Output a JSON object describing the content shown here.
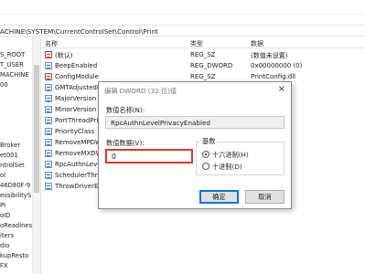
{
  "menubar": {
    "items": [
      "",
      "",
      "",
      "",
      ""
    ]
  },
  "address": {
    "path": "ACHINE\\SYSTEM\\CurrentControlSet\\Control\\Print"
  },
  "tree": {
    "items": [
      "S_ROOT",
      "T_USER",
      "MACHINE",
      "00",
      "",
      "",
      "",
      "",
      "",
      "",
      "",
      "Broker",
      "et001",
      "ntrolSet",
      "ol",
      "46D80F-9",
      "essibilityS",
      "PI",
      "oID",
      "oReadines",
      "iters",
      "dio",
      "kupResto",
      "FX"
    ]
  },
  "list": {
    "headers": {
      "name": "名称",
      "type": "类型",
      "data": "数据"
    },
    "rows": [
      {
        "name": "(默认)",
        "type": "REG_SZ",
        "data": "(数值未设置)",
        "kind": "str"
      },
      {
        "name": "BeepEnabled",
        "type": "REG_DWORD",
        "data": "0x00000000 (0)",
        "kind": "bin"
      },
      {
        "name": "ConfigModule",
        "type": "REG_SZ",
        "data": "PrintConfig.dll",
        "kind": "str"
      },
      {
        "name": "GMTAdjustedFo",
        "type": "",
        "data": "",
        "kind": "bin"
      },
      {
        "name": "MajorVersion",
        "type": "",
        "data": "",
        "kind": "bin"
      },
      {
        "name": "MinorVersion",
        "type": "",
        "data": "",
        "kind": "bin"
      },
      {
        "name": "PortThreadPrior",
        "type": "",
        "data": "",
        "kind": "bin"
      },
      {
        "name": "PriorityClass",
        "type": "",
        "data": "",
        "kind": "bin"
      },
      {
        "name": "RemoveMPDW",
        "type": "",
        "data": "",
        "kind": "bin"
      },
      {
        "name": "RemoveMXDW",
        "type": "",
        "data": "",
        "kind": "bin"
      },
      {
        "name": "RpcAuthnLevelP",
        "type": "",
        "data": "",
        "kind": "bin"
      },
      {
        "name": "SchedulerThread",
        "type": "",
        "data": "",
        "kind": "bin"
      },
      {
        "name": "ThrowDriverExc",
        "type": "",
        "data": "",
        "kind": "bin"
      }
    ]
  },
  "dialog": {
    "title": "编辑 DWORD (32 位)值",
    "name_label": "数值名称(N):",
    "value_name": "RpcAuthnLevelPrivacyEnabled",
    "data_label": "数值数据(V):",
    "value_data": "0",
    "base_label": "基数",
    "hex_label": "十六进制(H)",
    "dec_label": "十进制(D)",
    "selected_base": "hex",
    "ok_label": "确定",
    "cancel_label": "取消",
    "close_glyph": "×"
  },
  "colors": {
    "highlight_border": "#d93a2b",
    "primary_button_border": "#0078d7"
  }
}
